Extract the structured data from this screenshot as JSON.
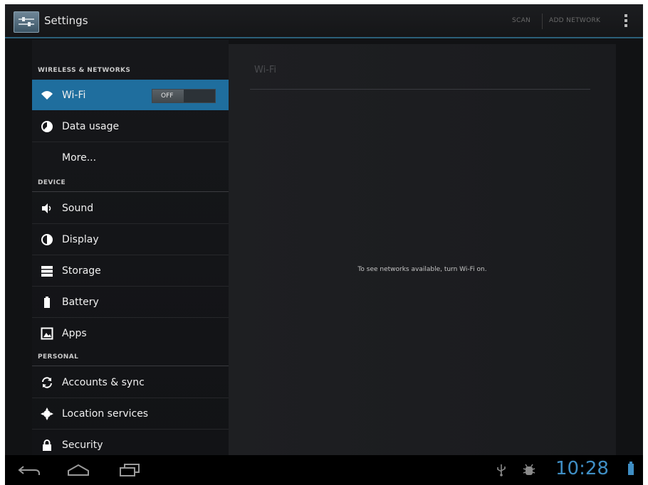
{
  "action_bar": {
    "title": "Settings",
    "scan_label": "SCAN",
    "add_network_label": "ADD NETWORK"
  },
  "sidebar": {
    "sections": [
      {
        "header": "WIRELESS & NETWORKS",
        "items": [
          {
            "label": "Wi-Fi",
            "icon": "wifi-icon",
            "toggle": "OFF",
            "selected": true
          },
          {
            "label": "Data usage",
            "icon": "data-usage-icon"
          },
          {
            "label": "More...",
            "icon": ""
          }
        ]
      },
      {
        "header": "DEVICE",
        "items": [
          {
            "label": "Sound",
            "icon": "sound-icon"
          },
          {
            "label": "Display",
            "icon": "display-icon"
          },
          {
            "label": "Storage",
            "icon": "storage-icon"
          },
          {
            "label": "Battery",
            "icon": "battery-icon"
          },
          {
            "label": "Apps",
            "icon": "apps-icon"
          }
        ]
      },
      {
        "header": "PERSONAL",
        "items": [
          {
            "label": "Accounts & sync",
            "icon": "sync-icon"
          },
          {
            "label": "Location services",
            "icon": "location-icon"
          },
          {
            "label": "Security",
            "icon": "lock-icon"
          }
        ]
      }
    ]
  },
  "detail": {
    "title": "Wi-Fi",
    "empty_message": "To see networks available, turn Wi-Fi on."
  },
  "status_bar": {
    "time": "10:28"
  },
  "colors": {
    "accent": "#1f6e9e",
    "clock": "#3f8ec4",
    "background": "#111214"
  }
}
